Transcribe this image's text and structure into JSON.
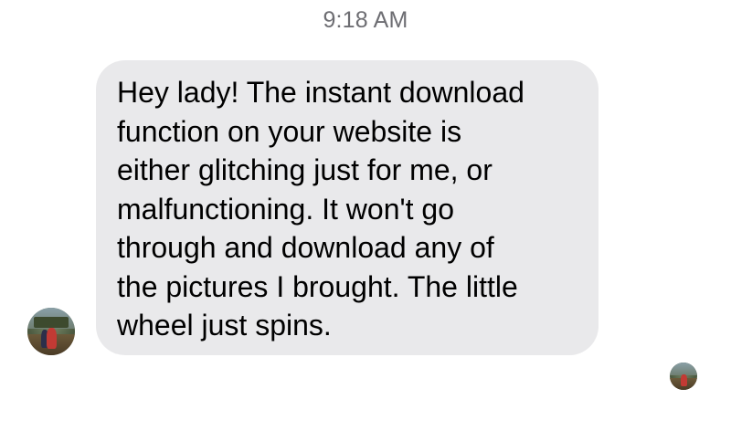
{
  "conversation": {
    "timestamp": "9:18 AM",
    "messages": [
      {
        "direction": "incoming",
        "text": "Hey lady! The instant download\nfunction on your website is\neither glitching just for me, or\nmalfunctioning. It won't go\nthrough and download any of\nthe pictures I brought. The little\nwheel just spins."
      }
    ]
  },
  "colors": {
    "incoming_bubble": "#e9e9eb",
    "timestamp_text": "#6d6d72",
    "message_text": "#000000",
    "background": "#ffffff"
  },
  "icons": {
    "sender_avatar": "sender-avatar-photo",
    "read_receipt_avatar": "read-receipt-avatar-photo"
  }
}
